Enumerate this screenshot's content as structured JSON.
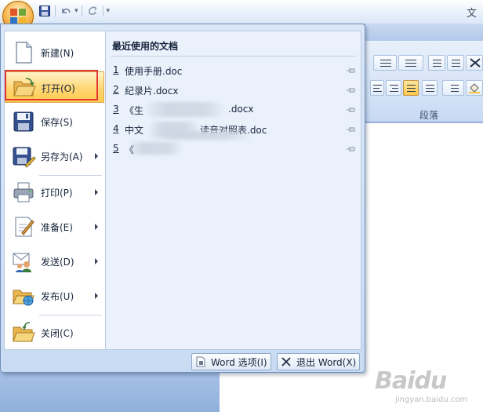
{
  "app": {
    "title_fragment": "文"
  },
  "ribbon": {
    "group_label": "段落"
  },
  "menu": {
    "items": [
      {
        "label": "新建(N)",
        "icon": "new-document-icon"
      },
      {
        "label": "打开(O)",
        "icon": "open-folder-icon",
        "selected": true
      },
      {
        "label": "保存(S)",
        "icon": "save-icon"
      },
      {
        "label": "另存为(A)",
        "icon": "save-as-icon",
        "has_submenu": true
      },
      {
        "label": "打印(P)",
        "icon": "print-icon",
        "has_submenu": true
      },
      {
        "label": "准备(E)",
        "icon": "prepare-icon",
        "has_submenu": true
      },
      {
        "label": "发送(D)",
        "icon": "send-icon",
        "has_submenu": true
      },
      {
        "label": "发布(U)",
        "icon": "publish-icon",
        "has_submenu": true
      },
      {
        "label": "关闭(C)",
        "icon": "close-document-icon"
      }
    ],
    "recent": {
      "heading": "最近使用的文档",
      "items": [
        {
          "num": "1",
          "name": "使用手册.doc"
        },
        {
          "num": "2",
          "name": "纪录片.docx"
        },
        {
          "num": "3",
          "name": "《生",
          "name_end": ".docx"
        },
        {
          "num": "4",
          "name": "中文",
          "name_end": "读音对照表.doc"
        },
        {
          "num": "5",
          "name": "《"
        }
      ]
    },
    "bottom": {
      "options_label": "Word 选项(I)",
      "exit_label": "退出 Word(X)"
    }
  },
  "watermark": {
    "logo": "Baidu",
    "sub": "jingyan.baidu.com"
  },
  "colors": {
    "selected_highlight": "#ffd87a",
    "annotation_red": "#e23636",
    "menu_background": "#dbe7f7"
  }
}
